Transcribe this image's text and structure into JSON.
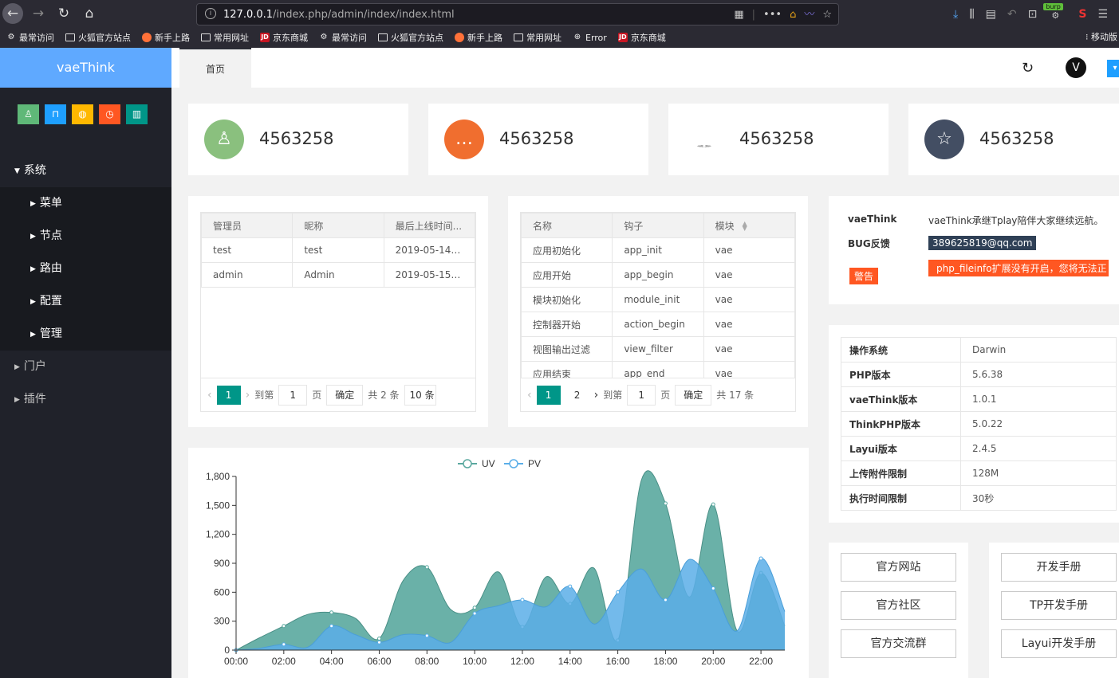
{
  "browser": {
    "url_host": "127.0.0.1",
    "url_path": "/index.php/admin/index/index.html",
    "burp_label": "burp",
    "bookmarks": [
      {
        "label": "最常访问",
        "icon": "gear-icon"
      },
      {
        "label": "火狐官方站点",
        "icon": "folder-icon"
      },
      {
        "label": "新手上路",
        "icon": "firefox-icon"
      },
      {
        "label": "常用网址",
        "icon": "folder-icon"
      },
      {
        "label": "京东商城",
        "icon": "jd-icon"
      },
      {
        "label": "最常访问",
        "icon": "gear-icon"
      },
      {
        "label": "火狐官方站点",
        "icon": "folder-icon"
      },
      {
        "label": "新手上路",
        "icon": "firefox-icon"
      },
      {
        "label": "常用网址",
        "icon": "folder-icon"
      },
      {
        "label": "Error",
        "icon": "globe-icon"
      },
      {
        "label": "京东商城",
        "icon": "jd-icon"
      }
    ],
    "more_bookmarks": "移动版"
  },
  "app": {
    "logo": "vaeThink",
    "jd_glyph": "JD",
    "avatar_glyph": "V",
    "quick_buttons": [
      {
        "icon": "user-icon",
        "color": "#5fb878"
      },
      {
        "icon": "lock-icon",
        "color": "#1e9fff"
      },
      {
        "icon": "globe-icon",
        "color": "#ffb800"
      },
      {
        "icon": "clock-icon",
        "color": "#ff5722"
      },
      {
        "icon": "trash-icon",
        "color": "#009688"
      }
    ],
    "menu": {
      "system": "系统",
      "system_children": [
        "菜单",
        "节点",
        "路由",
        "配置",
        "管理"
      ],
      "portal": "门户",
      "plugin": "插件"
    },
    "tab_home": "首页"
  },
  "stats": [
    {
      "value": "4563258",
      "icon": "user-icon",
      "color": "#8ac07e"
    },
    {
      "value": "4563258",
      "icon": "chat-icon",
      "color": "#f06e2f"
    },
    {
      "value": "4563258",
      "icon": "bell-icon",
      "color": "#56acec"
    },
    {
      "value": "4563258",
      "icon": "star-icon",
      "color": "#434e63"
    }
  ],
  "admin_table": {
    "headers": [
      "管理员",
      "昵称",
      "最后上线时间..."
    ],
    "rows": [
      [
        "test",
        "test",
        "2019-05-14 2..."
      ],
      [
        "admin",
        "Admin",
        "2019-05-15 0..."
      ]
    ],
    "pager": {
      "cur": "1",
      "goto": "到第",
      "input": "1",
      "page": "页",
      "ok": "确定",
      "total": "共 2 条",
      "per": "10 条"
    }
  },
  "hook_table": {
    "headers": [
      "名称",
      "钩子",
      "模块"
    ],
    "rows": [
      [
        "应用初始化",
        "app_init",
        "vae"
      ],
      [
        "应用开始",
        "app_begin",
        "vae"
      ],
      [
        "模块初始化",
        "module_init",
        "vae"
      ],
      [
        "控制器开始",
        "action_begin",
        "vae"
      ],
      [
        "视图输出过滤",
        "view_filter",
        "vae"
      ],
      [
        "应用结束",
        "app_end",
        "vae"
      ]
    ],
    "pager": {
      "cur": "1",
      "next_page": "2",
      "goto": "到第",
      "input": "1",
      "page": "页",
      "ok": "确定",
      "total": "共 17 条"
    }
  },
  "info_box": {
    "k1": "vaeThink",
    "v1": "vaeThink承继Tplay陪伴大家继续远航。",
    "k2": "BUG反馈",
    "v2": "389625819@qq.com",
    "k3": "警告",
    "v3": "php_fileinfo扩展没有开启，您将无法正"
  },
  "sysinfo": [
    [
      "操作系统",
      "Darwin"
    ],
    [
      "PHP版本",
      "5.6.38"
    ],
    [
      "vaeThink版本",
      "1.0.1"
    ],
    [
      "ThinkPHP版本",
      "5.0.22"
    ],
    [
      "Layui版本",
      "2.4.5"
    ],
    [
      "上传附件限制",
      "128M"
    ],
    [
      "执行时间限制",
      "30秒"
    ]
  ],
  "links_left": [
    "官方网站",
    "官方社区",
    "官方交流群"
  ],
  "links_right": [
    "开发手册",
    "TP开发手册",
    "Layui开发手册"
  ],
  "chart_data": {
    "type": "area",
    "categories": [
      "00:00",
      "01:00",
      "02:00",
      "03:00",
      "04:00",
      "05:00",
      "06:00",
      "07:00",
      "08:00",
      "09:00",
      "10:00",
      "11:00",
      "12:00",
      "13:00",
      "14:00",
      "15:00",
      "16:00",
      "17:00",
      "18:00",
      "19:00",
      "20:00",
      "21:00",
      "22:00",
      "23:00"
    ],
    "x_tick_labels": [
      "00:00",
      "02:00",
      "04:00",
      "06:00",
      "08:00",
      "10:00",
      "12:00",
      "14:00",
      "16:00",
      "18:00",
      "20:00",
      "22:00"
    ],
    "series": [
      {
        "name": "UV",
        "color": "#5aa89f",
        "values": [
          0,
          130,
          250,
          370,
          390,
          330,
          120,
          720,
          860,
          420,
          440,
          810,
          240,
          760,
          480,
          850,
          100,
          1770,
          1520,
          550,
          1510,
          200,
          800,
          250
        ]
      },
      {
        "name": "PV",
        "color": "#5aaee8",
        "values": [
          0,
          20,
          60,
          30,
          250,
          160,
          80,
          160,
          150,
          80,
          380,
          460,
          520,
          450,
          660,
          270,
          600,
          840,
          520,
          940,
          640,
          200,
          950,
          400
        ]
      }
    ],
    "ylim": [
      0,
      1800
    ],
    "yticks": [
      0,
      300,
      600,
      900,
      1200,
      1500,
      1800
    ],
    "ytick_labels": [
      "0",
      "300",
      "600",
      "900",
      "1,200",
      "1,500",
      "1,800"
    ],
    "legend": "top-center"
  }
}
